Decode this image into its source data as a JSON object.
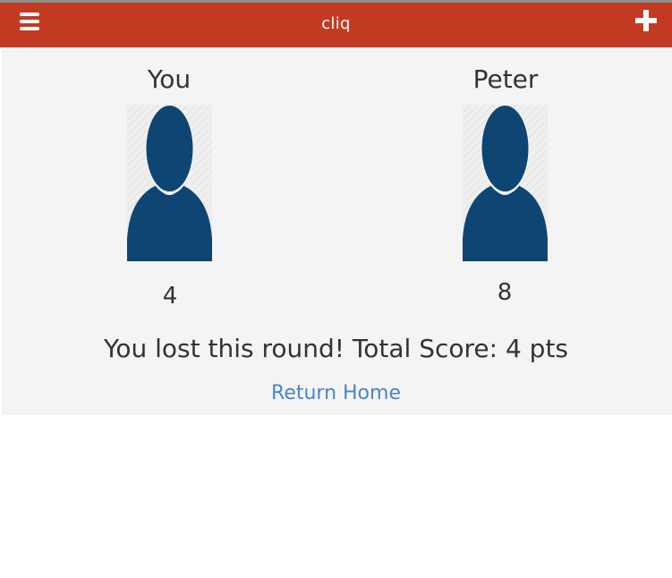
{
  "navbar": {
    "title": "cliq",
    "menu_icon": "hamburger-menu-icon",
    "add_icon": "plus-icon",
    "color": "#c33a22"
  },
  "players": [
    {
      "name": "You",
      "score": "4"
    },
    {
      "name": "Peter",
      "score": "8"
    }
  ],
  "result": {
    "message": "You lost this round! Total Score: 4 pts"
  },
  "actions": {
    "home_label": "Return Home"
  },
  "colors": {
    "avatar": "#0f4573",
    "link": "#4a86c5",
    "panel_bg": "#f4f4f4"
  }
}
